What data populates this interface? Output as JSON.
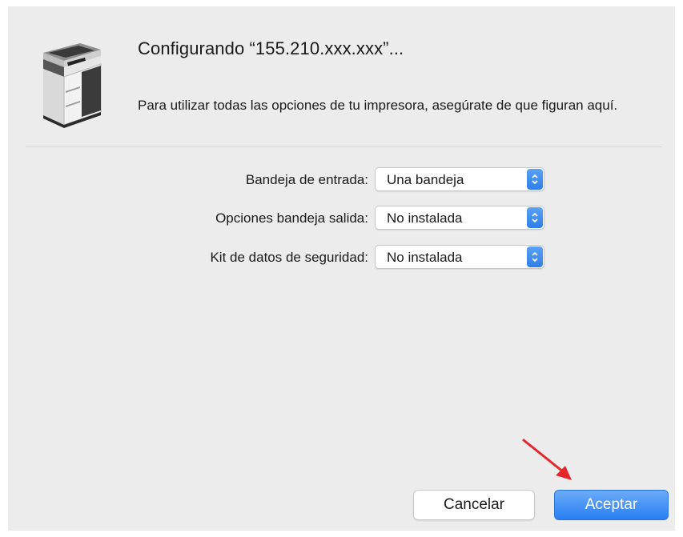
{
  "dialog": {
    "title": "Configurando “155.210.xxx.xxx”...",
    "description": "Para utilizar todas las opciones de tu impresora, asegúrate de que figuran aquí."
  },
  "options": [
    {
      "label": "Bandeja de entrada:",
      "value": "Una bandeja"
    },
    {
      "label": "Opciones bandeja salida:",
      "value": "No instalada"
    },
    {
      "label": "Kit de datos de seguridad:",
      "value": "No instalada"
    }
  ],
  "buttons": {
    "cancel": "Cancelar",
    "accept": "Aceptar"
  },
  "icons": {
    "printer": "printer-icon",
    "popup": "up-down-chevron-icon",
    "annotation": "red-arrow-icon"
  },
  "colors": {
    "accent": "#2a7ef2",
    "dialog_bg": "#ececec",
    "annotation_arrow": "#e4262a"
  }
}
